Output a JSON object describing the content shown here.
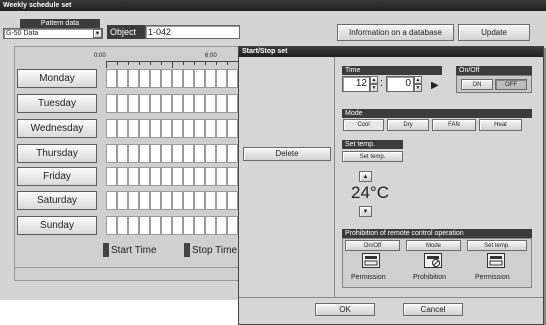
{
  "main_window": {
    "title": "Weekly schedule set",
    "pattern_label": "Pattern data",
    "pattern_value": "G-50 Data",
    "object_label": "Object",
    "object_value": "1-042",
    "info_button": "Information on a database",
    "update_button": "Update",
    "time_ticks": [
      "0:00",
      "6:00"
    ],
    "days": [
      "Monday",
      "Tuesday",
      "Wednesday",
      "Thursday",
      "Friday",
      "Saturday",
      "Sunday"
    ],
    "legend": {
      "start": "Start Time",
      "stop": "Stop Time"
    }
  },
  "dialog": {
    "title": "Start/Stop set",
    "delete_button": "Delete",
    "time": {
      "label": "Time",
      "hour": "12",
      "minute": "0",
      "separator": ":"
    },
    "onoff": {
      "label": "On/Off",
      "on": "ON",
      "off": "OFF"
    },
    "mode": {
      "label": "Mode",
      "options": [
        "Cool",
        "Dry",
        "FAN",
        "Heat"
      ],
      "selected": "Cool"
    },
    "set_temp": {
      "label": "Set temp.",
      "button": "Set temp.",
      "value": "24°C"
    },
    "prohibition": {
      "label": "Prohibition of remote control operation",
      "items": [
        {
          "button": "On/Off",
          "status": "Permission",
          "icon": "remote-icon"
        },
        {
          "button": "Mode",
          "status": "Prohibition",
          "icon": "remote-prohibited-icon"
        },
        {
          "button": "Set temp.",
          "status": "Permission",
          "icon": "remote-icon"
        }
      ]
    },
    "ok_button": "OK",
    "cancel_button": "Cancel"
  },
  "colors": {
    "titlebar": "#2a2a2a",
    "panel": "#d6d6d6",
    "section": "#3c3c3c"
  }
}
